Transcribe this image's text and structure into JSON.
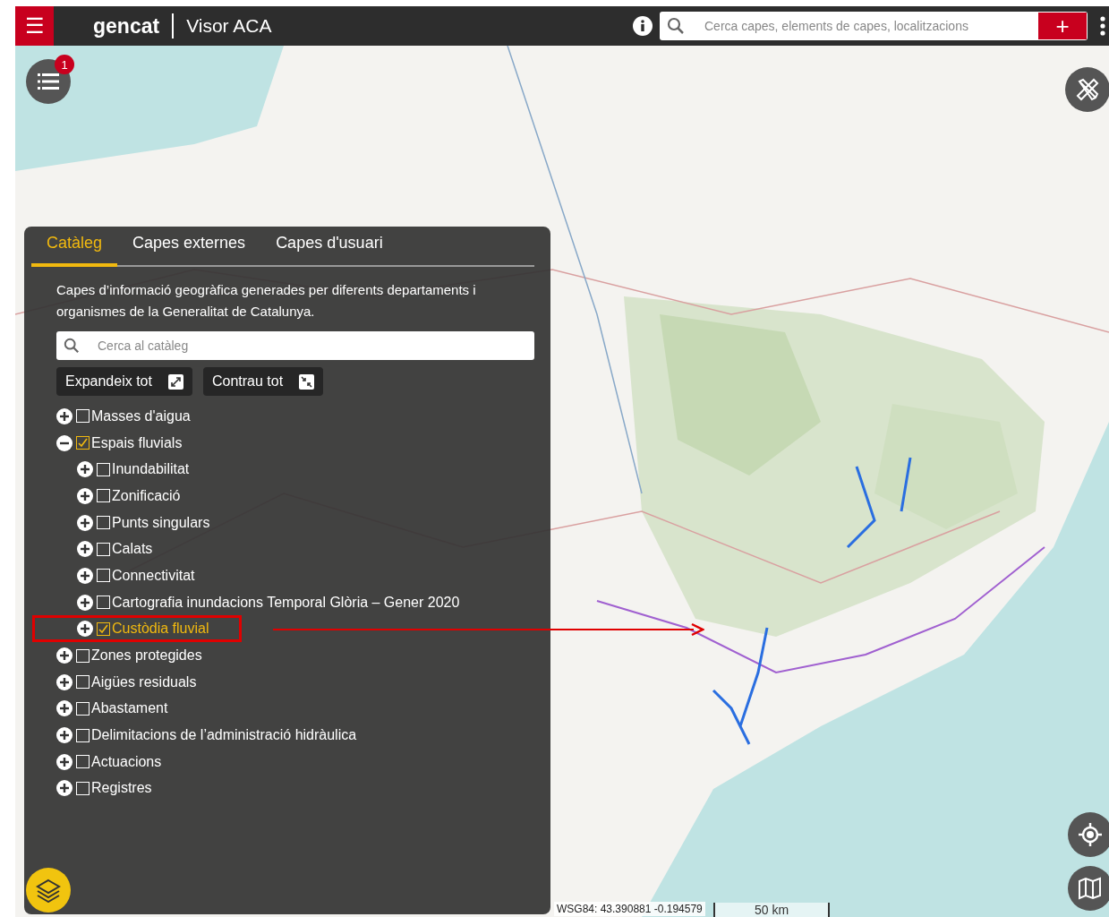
{
  "header": {
    "menu_icon": "☰",
    "brand": "gencat",
    "app_title": "Visor ACA",
    "search": {
      "placeholder": "Cerca capes, elements de capes, localitzacions"
    },
    "add_button": "+"
  },
  "legend_badge": "1",
  "panel": {
    "tabs": [
      {
        "label": "Catàleg",
        "selected": true
      },
      {
        "label": "Capes externes",
        "selected": false
      },
      {
        "label": "Capes d'usuari",
        "selected": false
      }
    ],
    "description": "Capes d’informació geogràfica generades per diferents departaments i organismes de la Generalitat de Catalunya.",
    "search": {
      "placeholder": "Cerca al catàleg"
    },
    "buttons": [
      {
        "label": "Expandeix tot",
        "kind": "expand"
      },
      {
        "label": "Contrau tot",
        "kind": "collapse"
      }
    ],
    "tree": [
      {
        "label": "Masses d'aigua",
        "checked": false,
        "expanded": false,
        "selected": false
      },
      {
        "label": "Espais fluvials",
        "checked": true,
        "expanded": true,
        "selected": false,
        "children": [
          {
            "label": "Inundabilitat",
            "checked": false,
            "expanded": false,
            "selected": false
          },
          {
            "label": "Zonificació",
            "checked": false,
            "expanded": false,
            "selected": false
          },
          {
            "label": "Punts singulars",
            "checked": false,
            "expanded": false,
            "selected": false
          },
          {
            "label": "Calats",
            "checked": false,
            "expanded": false,
            "selected": false
          },
          {
            "label": "Connectivitat",
            "checked": false,
            "expanded": false,
            "selected": false
          },
          {
            "label": "Cartografia inundacions Temporal Glòria – Gener 2020",
            "checked": false,
            "expanded": false,
            "selected": false
          },
          {
            "label": "Custòdia fluvial",
            "checked": true,
            "expanded": false,
            "selected": true
          }
        ]
      },
      {
        "label": "Zones protegides",
        "checked": false,
        "expanded": false,
        "selected": false
      },
      {
        "label": "Aigües residuals",
        "checked": false,
        "expanded": false,
        "selected": false
      },
      {
        "label": "Abastament",
        "checked": false,
        "expanded": false,
        "selected": false
      },
      {
        "label": "Delimitacions de l’administració hidràulica",
        "checked": false,
        "expanded": false,
        "selected": false
      },
      {
        "label": "Actuacions",
        "checked": false,
        "expanded": false,
        "selected": false
      },
      {
        "label": "Registres",
        "checked": false,
        "expanded": false,
        "selected": false
      }
    ]
  },
  "coordinates": "WSG84: 43.390881 -0.194579",
  "scale": "50 km"
}
